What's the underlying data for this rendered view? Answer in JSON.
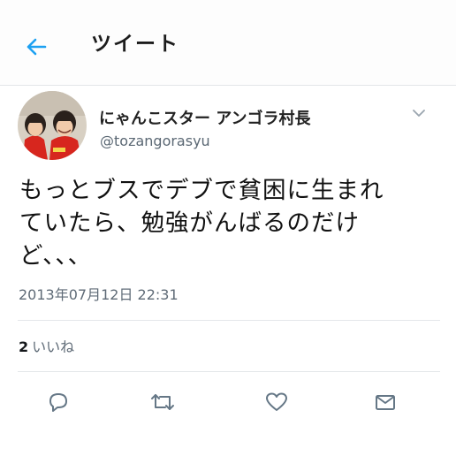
{
  "header": {
    "title": "ツイート",
    "back_icon": "arrow-left-icon"
  },
  "author": {
    "display_name": "にゃんこスター アンゴラ村長",
    "handle": "@tozangorasyu"
  },
  "tweet": {
    "text": "もっとブスでデブで貧困に生まれ\nていたら、勉強がんばるのだけ\nど、、、",
    "timestamp": "2013年07月12日 22:31"
  },
  "stats": {
    "likes_count": "2",
    "likes_label": "いいね"
  },
  "actions": {
    "reply_icon": "reply-icon",
    "retweet_icon": "retweet-icon",
    "like_icon": "heart-icon",
    "message_icon": "envelope-icon"
  },
  "colors": {
    "accent": "#1da1f2",
    "icon_gray": "#657786",
    "avatar_bg": "#d8d0c3",
    "avatar_shirt": "#d7261e"
  }
}
